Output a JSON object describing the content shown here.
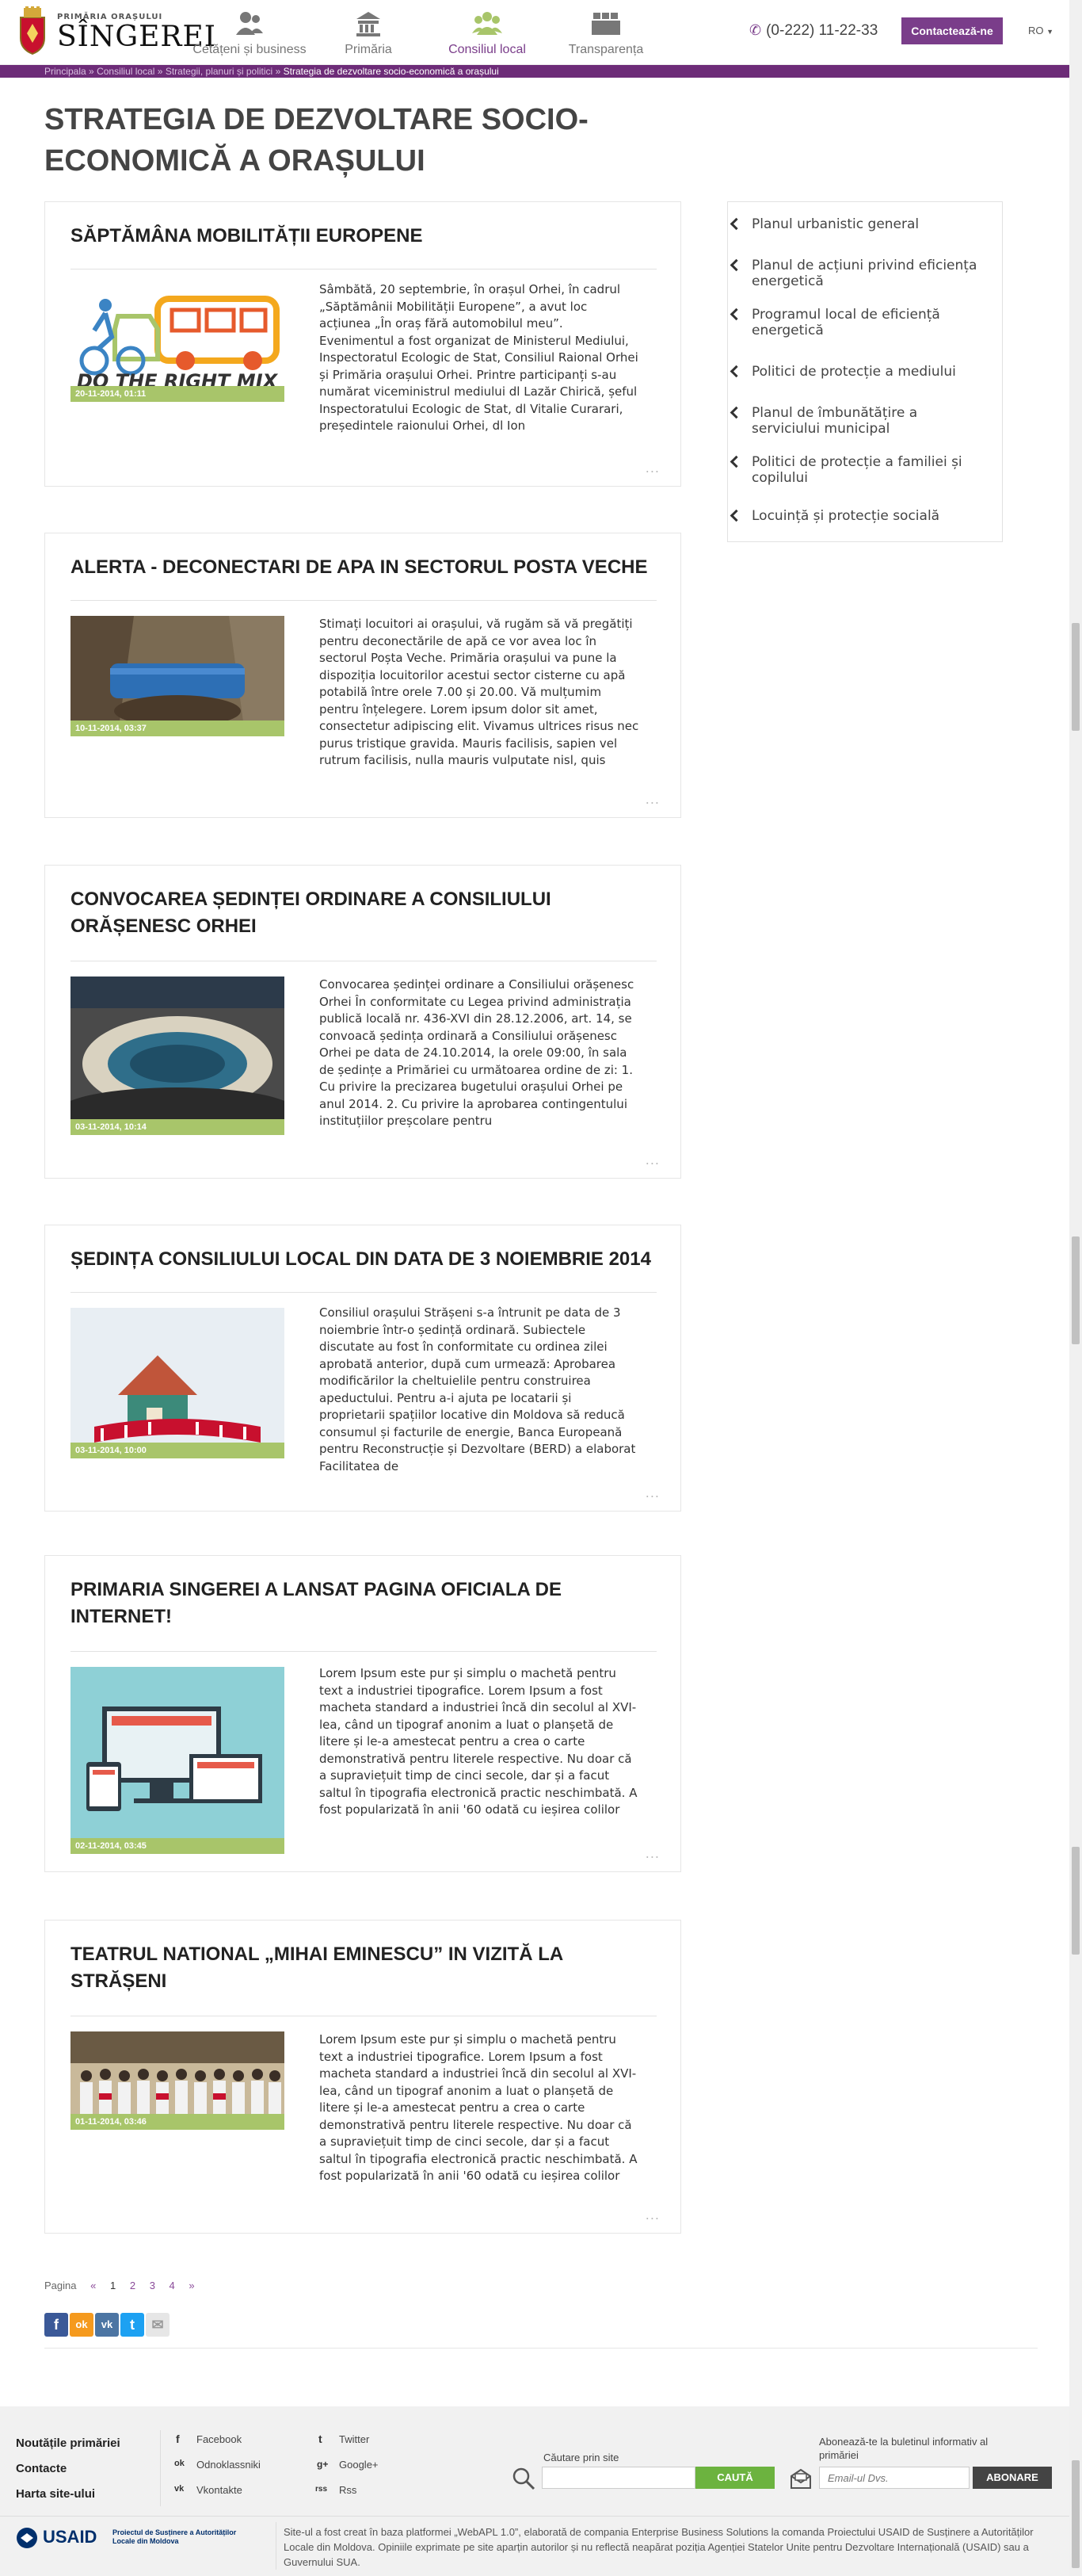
{
  "header": {
    "logo_top": "PRIMĂRIA ORAȘULUI",
    "logo_name": "SÎNGEREI",
    "nav": [
      {
        "label": "Cetățeni și business",
        "icon": "people-icon"
      },
      {
        "label": "Primăria",
        "icon": "building-icon"
      },
      {
        "label": "Consiliul local",
        "icon": "council-icon"
      },
      {
        "label": "Transparența",
        "icon": "documents-icon"
      }
    ],
    "active_nav": "Consiliul local",
    "phone": "(0-222) 11-22-33",
    "contact_label": "Contactează-ne",
    "lang": "RO"
  },
  "breadcrumb": {
    "items": [
      "Principala",
      "Consiliul local",
      "Strategii, planuri și politici"
    ],
    "current": "Strategia de dezvoltare socio-economică a orașului",
    "sep": "»"
  },
  "page_title": "STRATEGIA DE DEZVOLTARE SOCIO-ECONOMICĂ A ORAȘULUI",
  "articles": [
    {
      "title": "SĂPTĂMÂNA MOBILITĂȚII EUROPENE",
      "date": "20-11-2014, 01:11",
      "image_caption": "DO THE RIGHT MIX",
      "text": "Sâmbătă, 20 septembrie, în orașul Orhei, în cadrul „Săptămânii Mobilității Europene”, a avut loc acțiunea „În oraș fără automobilul meu”. Evenimentul a fost organizat de Ministerul Mediului, Inspectoratul Ecologic de Stat, Consiliul Raional Orhei și Primăria orașului Orhei. Printre participanți s-au numărat viceministrul mediului dl Lazăr Chirică, șeful Inspectoratului Ecologic de Stat, dl Vitalie Curarari, președintele raionului Orhei, dl Ion"
    },
    {
      "title": "ALERTA - DECONECTARI DE APA IN SECTORUL POSTA VECHE",
      "date": "10-11-2014, 03:37",
      "text": "Stimați locuitori ai orașului, vă rugăm să vă pregătiți pentru deconectările de apă ce vor avea loc în sectorul Poșta Veche. Primăria orașului va pune la dispoziția locuitorilor acestui sector cisterne cu apă potabilă între orele 7.00 și 20.00. Vă mulțumim pentru înțelegere. Lorem ipsum dolor sit amet, consectetur adipiscing elit. Vivamus ultrices risus nec purus tristique gravida. Mauris facilisis, sapien vel rutrum facilisis, nulla mauris vulputate nisl, quis"
    },
    {
      "title": "CONVOCAREA ȘEDINȚEI ORDINARE A CONSILIULUI ORĂȘENESC ORHEI",
      "date": "03-11-2014, 10:14",
      "text": "Convocarea ședinței ordinare a Consiliului orășenesc Orhei În conformitate cu Legea privind administrația publică locală nr. 436-XVI din 28.12.2006, art. 14, se convoacă ședința ordinară a Consiliului orășenesc Orhei pe data de 24.10.2014, la orele 09:00, în sala de ședințe a Primăriei cu următoarea ordine de zi: 1. Cu privire la precizarea bugetului orașului Orhei pe anul 2014. 2. Cu privire la aprobarea contingentului instituțiilor preșcolare pentru"
    },
    {
      "title": "ȘEDINȚA CONSILIULUI LOCAL DIN DATA DE 3 NOIEMBRIE 2014",
      "date": "03-11-2014, 10:00",
      "text": "Consiliul orașului Strășeni s-a întrunit pe data de 3 noiembrie într-o ședință ordinară. Subiectele discutate au fost în conformitate cu ordinea zilei aprobată anterior, după cum urmează: Aprobarea modificărilor la cheltuielile pentru construirea apeductului. Pentru a-i ajuta pe locatarii și proprietarii spațiilor locative din Moldova să reducă consumul și facturile de energie, Banca Europeană pentru Reconstrucție și Dezvoltare (BERD) a elaborat Facilitatea de"
    },
    {
      "title": "PRIMARIA SINGEREI A LANSAT PAGINA OFICIALA DE INTERNET!",
      "date": "02-11-2014, 03:45",
      "text": "Lorem Ipsum este pur și simplu o machetă pentru text a industriei tipografice. Lorem Ipsum a fost macheta standard a industriei încă din secolul al XVI-lea, când un tipograf anonim a luat o planșetă de litere și le-a amestecat pentru a crea o carte demonstrativă pentru literele respective. Nu doar că a supraviețuit timp de cinci secole, dar și a facut saltul în tipografia electronică practic neschimbată. A fost popularizată în anii '60 odată cu ieșirea colilor"
    },
    {
      "title": "TEATRUL NATIONAL „MIHAI EMINESCU” IN VIZITĂ LA STRĂȘENI",
      "date": "01-11-2014, 03:46",
      "text": "Lorem Ipsum este pur și simplu o machetă pentru text a industriei tipografice. Lorem Ipsum a fost macheta standard a industriei încă din secolul al XVI-lea, când un tipograf anonim a luat o planșetă de litere și le-a amestecat pentru a crea o carte demonstrativă pentru literele respective. Nu doar că a supraviețuit timp de cinci secole, dar și a facut saltul în tipografia electronică practic neschimbată. A fost popularizată în anii '60 odată cu ieșirea colilor"
    }
  ],
  "more_label": "...",
  "sidebar": [
    "Planul urbanistic general",
    "Planul de acțiuni privind eficiența energetică",
    "Programul local de eficiență energetică",
    "Politici de protecție a mediului",
    "Planul de îmbunătățire a serviciului municipal",
    "Politici de protecție a familiei și copilului",
    "Locuință și protecție socială"
  ],
  "pagination": {
    "label": "Pagina",
    "prev": "«",
    "pages": [
      "1",
      "2",
      "3",
      "4"
    ],
    "current": "1",
    "next": "»"
  },
  "share_icons": [
    {
      "name": "facebook-share-icon",
      "glyph": "f",
      "color": "#3b5998"
    },
    {
      "name": "odnoklassniki-share-icon",
      "glyph": "ok",
      "color": "#f59a1e"
    },
    {
      "name": "vkontakte-share-icon",
      "glyph": "vk",
      "color": "#4c75a3"
    },
    {
      "name": "twitter-share-icon",
      "glyph": "t",
      "color": "#1da1f2"
    },
    {
      "name": "email-share-icon",
      "glyph": "✉",
      "color": "#e6e6e6"
    }
  ],
  "footer": {
    "links": [
      "Noutățile primăriei",
      "Contacte",
      "Harta site-ului"
    ],
    "social_col1": [
      {
        "label": "Facebook",
        "glyph": "f"
      },
      {
        "label": "Odnoklassniki",
        "glyph": "ok"
      },
      {
        "label": "Vkontakte",
        "glyph": "vk"
      }
    ],
    "social_col2": [
      {
        "label": "Twitter",
        "glyph": "t"
      },
      {
        "label": "Google+",
        "glyph": "g+"
      },
      {
        "label": "Rss",
        "glyph": "rss"
      }
    ],
    "search_label": "Căutare prin site",
    "search_button": "CAUTĂ",
    "newsletter_label": "Abonează-te la buletinul informativ al primăriei",
    "email_placeholder": "Email-ul Dvs.",
    "subscribe_button": "ABONARE",
    "usaid": "USAID",
    "usaid_sub": "Proiectul de Susținere a Autorităților Locale din Moldova",
    "copyright": "Site-ul a fost creat în baza platformei „WebAPL 1.0”, elaborată de compania Enterprise Business Solutions la comanda Proiectului USAID de Susținere a Autorităților Locale din Moldova. Opiniile exprimate pe site aparțin autorilor și nu reflectă neapărat poziția Agenției Statelor Unite pentru Dezvoltare Internațională (USAID) sau a Guvernului SUA."
  },
  "colors": {
    "accent": "#7a3d8a",
    "breadcrumb_bg": "#6d2c78",
    "date_bar": "#a8c56a",
    "search_button": "#6cb33f",
    "subscribe_button": "#444444"
  }
}
